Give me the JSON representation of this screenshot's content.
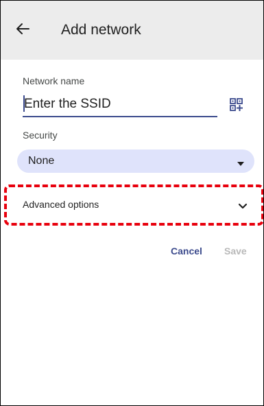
{
  "header": {
    "title": "Add network",
    "back_icon": "arrow-left-icon"
  },
  "network_name": {
    "label": "Network name",
    "placeholder": "Enter the SSID",
    "value": "",
    "scan_icon": "qr-code-scanner-icon"
  },
  "security": {
    "label": "Security",
    "selected": "None",
    "icon": "dropdown-arrow-icon"
  },
  "advanced": {
    "label": "Advanced options",
    "icon": "chevron-down-icon"
  },
  "actions": {
    "cancel_label": "Cancel",
    "save_label": "Save"
  },
  "colors": {
    "accent": "#3b4a8c",
    "select_bg": "#dfe3fb",
    "highlight": "#e8000d",
    "disabled": "#b8b8b8"
  }
}
